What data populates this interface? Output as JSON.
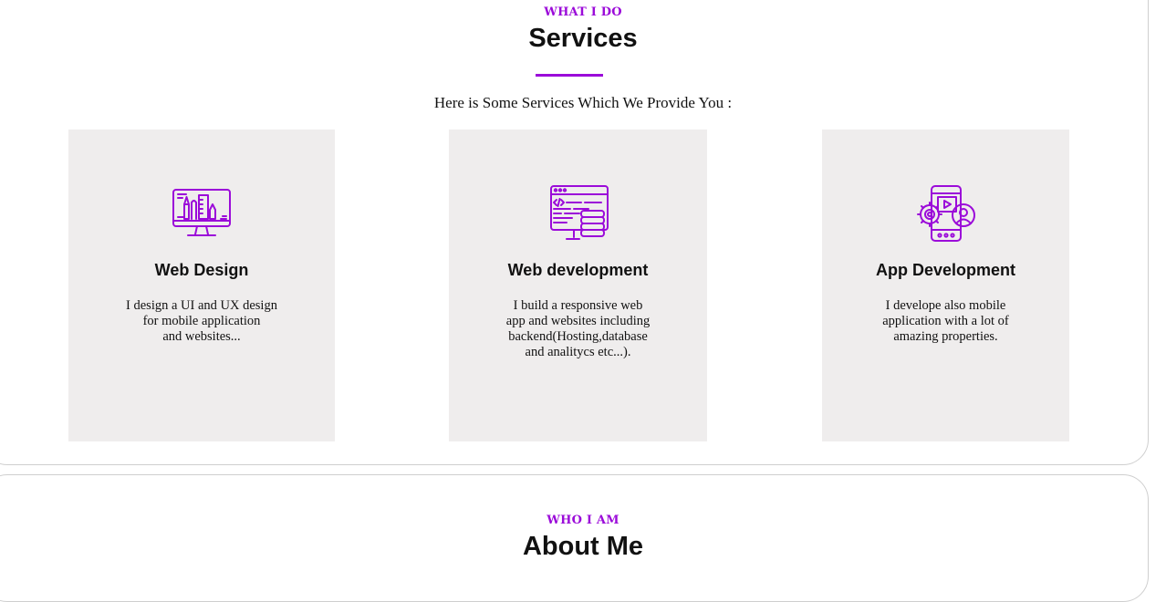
{
  "services": {
    "eyebrow": "WHAT I DO",
    "title": "Services",
    "intro": "Here is Some Services Which We Provide You :",
    "cards": [
      {
        "icon": "web-design-monitor-icon",
        "title": "Web Design",
        "text_lines": [
          "I design a UI and UX design",
          "for mobile application",
          "and websites..."
        ]
      },
      {
        "icon": "code-window-database-icon",
        "title": "Web development",
        "text_lines": [
          "I build a responsive web",
          "app and websites including",
          "backend(Hosting,database",
          "and analitycs etc...)."
        ]
      },
      {
        "icon": "mobile-app-gear-user-icon",
        "title": "App Development",
        "text_lines": [
          "I develope also mobile",
          "application with a lot of",
          "amazing properties."
        ]
      }
    ]
  },
  "about": {
    "eyebrow": "WHO I AM",
    "title": "About Me"
  },
  "colors": {
    "accent": "#9b0bd9",
    "card_bg": "#efeded",
    "text": "#111111",
    "border": "#cfcfcf"
  }
}
